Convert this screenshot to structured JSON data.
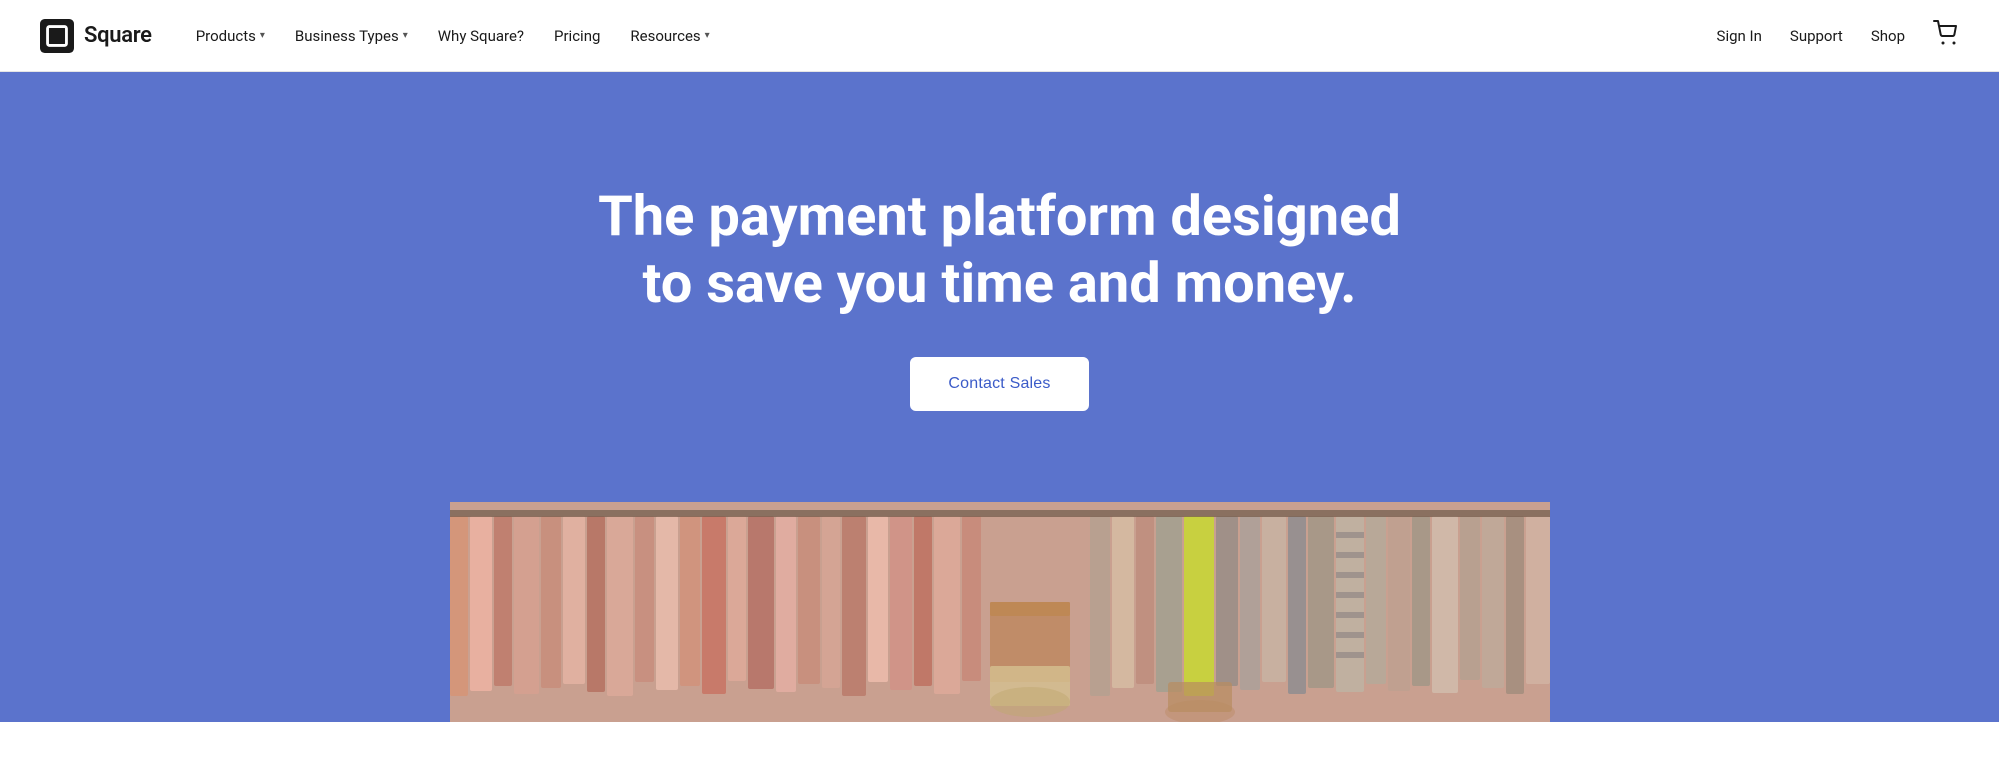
{
  "logo": {
    "text": "Square"
  },
  "navbar": {
    "left_items": [
      {
        "label": "Products",
        "has_dropdown": true
      },
      {
        "label": "Business Types",
        "has_dropdown": true
      },
      {
        "label": "Why Square?",
        "has_dropdown": false
      },
      {
        "label": "Pricing",
        "has_dropdown": false
      },
      {
        "label": "Resources",
        "has_dropdown": true
      }
    ],
    "right_items": [
      {
        "label": "Sign In"
      },
      {
        "label": "Support"
      },
      {
        "label": "Shop"
      }
    ]
  },
  "hero": {
    "title_line1": "The payment platform designed",
    "title_line2": "to save you time and money.",
    "cta_label": "Contact Sales",
    "bg_color": "#5b73cc"
  },
  "icons": {
    "square_logo": "▣",
    "cart": "🛒",
    "chevron_down": "▾"
  }
}
